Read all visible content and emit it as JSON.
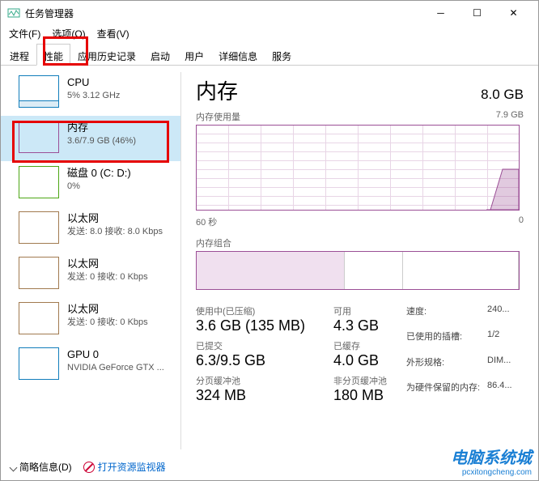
{
  "window": {
    "title": "任务管理器"
  },
  "menu": {
    "file": "文件(F)",
    "options": "选项(O)",
    "view": "查看(V)"
  },
  "tabs": [
    "进程",
    "性能",
    "应用历史记录",
    "启动",
    "用户",
    "详细信息",
    "服务"
  ],
  "sidebar": {
    "cpu": {
      "title": "CPU",
      "sub": "5% 3.12 GHz"
    },
    "mem": {
      "title": "内存",
      "sub": "3.6/7.9 GB (46%)"
    },
    "disk": {
      "title": "磁盘 0 (C: D:)",
      "sub": "0%"
    },
    "net1": {
      "title": "以太网",
      "sub": "发送: 8.0 接收: 8.0 Kbps"
    },
    "net2": {
      "title": "以太网",
      "sub": "发送: 0 接收: 0 Kbps"
    },
    "net3": {
      "title": "以太网",
      "sub": "发送: 0 接收: 0 Kbps"
    },
    "gpu": {
      "title": "GPU 0",
      "sub": "NVIDIA GeForce GTX ..."
    }
  },
  "main": {
    "title": "内存",
    "capacity": "8.0 GB",
    "usage_label": "内存使用量",
    "usage_max": "7.9 GB",
    "time_left": "60 秒",
    "time_right": "0",
    "comp_label": "内存组合",
    "stats": {
      "inuse_label": "使用中(已压缩)",
      "inuse_val": "3.6 GB (135 MB)",
      "avail_label": "可用",
      "avail_val": "4.3 GB",
      "commit_label": "已提交",
      "commit_val": "6.3/9.5 GB",
      "cached_label": "已缓存",
      "cached_val": "4.0 GB",
      "paged_label": "分页缓冲池",
      "paged_val": "324 MB",
      "nonpaged_label": "非分页缓冲池",
      "nonpaged_val": "180 MB"
    },
    "right": {
      "speed_l": "速度:",
      "speed_v": "240...",
      "slots_l": "已使用的插槽:",
      "slots_v": "1/2",
      "form_l": "外形规格:",
      "form_v": "DIM...",
      "reserved_l": "为硬件保留的内存:",
      "reserved_v": "86.4..."
    }
  },
  "footer": {
    "brief": "简略信息(D)",
    "resmon": "打开资源监视器"
  },
  "chart_data": {
    "type": "area",
    "title": "内存使用量",
    "xlabel": "60 秒 → 0",
    "ylabel": "GB",
    "ylim": [
      0,
      7.9
    ],
    "x": [
      60,
      5,
      2,
      0
    ],
    "values": [
      0,
      0,
      3.6,
      3.6
    ]
  }
}
